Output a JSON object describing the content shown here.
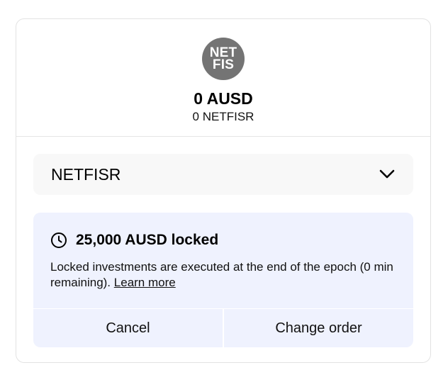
{
  "token": {
    "logo_line1": "NET",
    "logo_line2": "FIS",
    "logo_color": "#747474",
    "amount_primary": "0 AUSD",
    "amount_secondary": "0 NETFISR"
  },
  "tranche_select": {
    "value": "NETFISR",
    "icon": "chevron-down-icon"
  },
  "notice": {
    "icon": "clock-icon",
    "title": "25,000 AUSD locked",
    "description": "Locked investments are executed at the end of the epoch (0 min remaining).",
    "link_label": "Learn more",
    "background": "#eff2fe"
  },
  "actions": {
    "cancel_label": "Cancel",
    "change_label": "Change order"
  }
}
